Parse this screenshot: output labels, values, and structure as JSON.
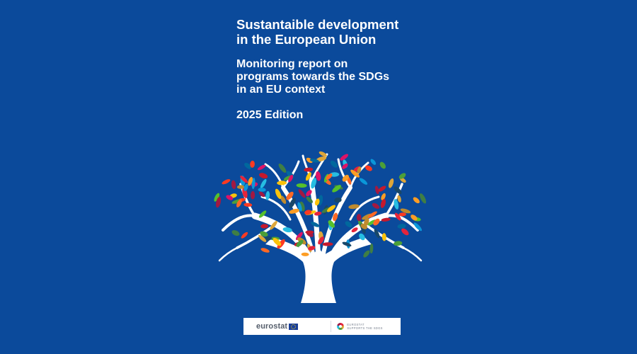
{
  "cover": {
    "title_lines": [
      "Sustantaible development",
      "in the European Union"
    ],
    "subtitle_lines": [
      "Monitoring report on",
      "programs towards the SDGs",
      "in an EU context"
    ],
    "edition": "2025 Edition"
  },
  "illustration": {
    "name": "sdg-tree",
    "trunk_color": "#ffffff",
    "leaf_colors": [
      "#e5243b",
      "#dda63a",
      "#4c9f38",
      "#c5192d",
      "#ff3a21",
      "#26bde2",
      "#fcc30b",
      "#a21942",
      "#fd6925",
      "#dd1367",
      "#fd9d24",
      "#bf8b2e",
      "#3f7e44",
      "#0a97d9",
      "#56c02b",
      "#00689d",
      "#19486a"
    ]
  },
  "logos": {
    "eurostat": "eurostat",
    "sdg_line1": "EUROSTAT",
    "sdg_line2": "SUPPORTS THE SDGs"
  },
  "colors": {
    "background": "#0b4a9b",
    "text": "#ffffff"
  }
}
